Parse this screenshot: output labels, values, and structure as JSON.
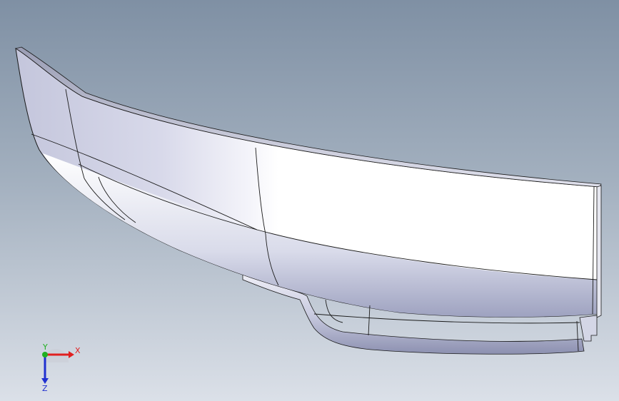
{
  "viewport": {
    "background_top": "#7f90a4",
    "background_bottom": "#dbe0e8"
  },
  "model": {
    "fill_light": "#ffffff",
    "fill_shade": "#b8bcd2",
    "edge_color": "#1a1a1a"
  },
  "triad": {
    "x_label": "X",
    "y_label": "Y",
    "z_label": "Z",
    "x_color": "#e02020",
    "y_color": "#20b020",
    "z_color": "#2030d0"
  }
}
